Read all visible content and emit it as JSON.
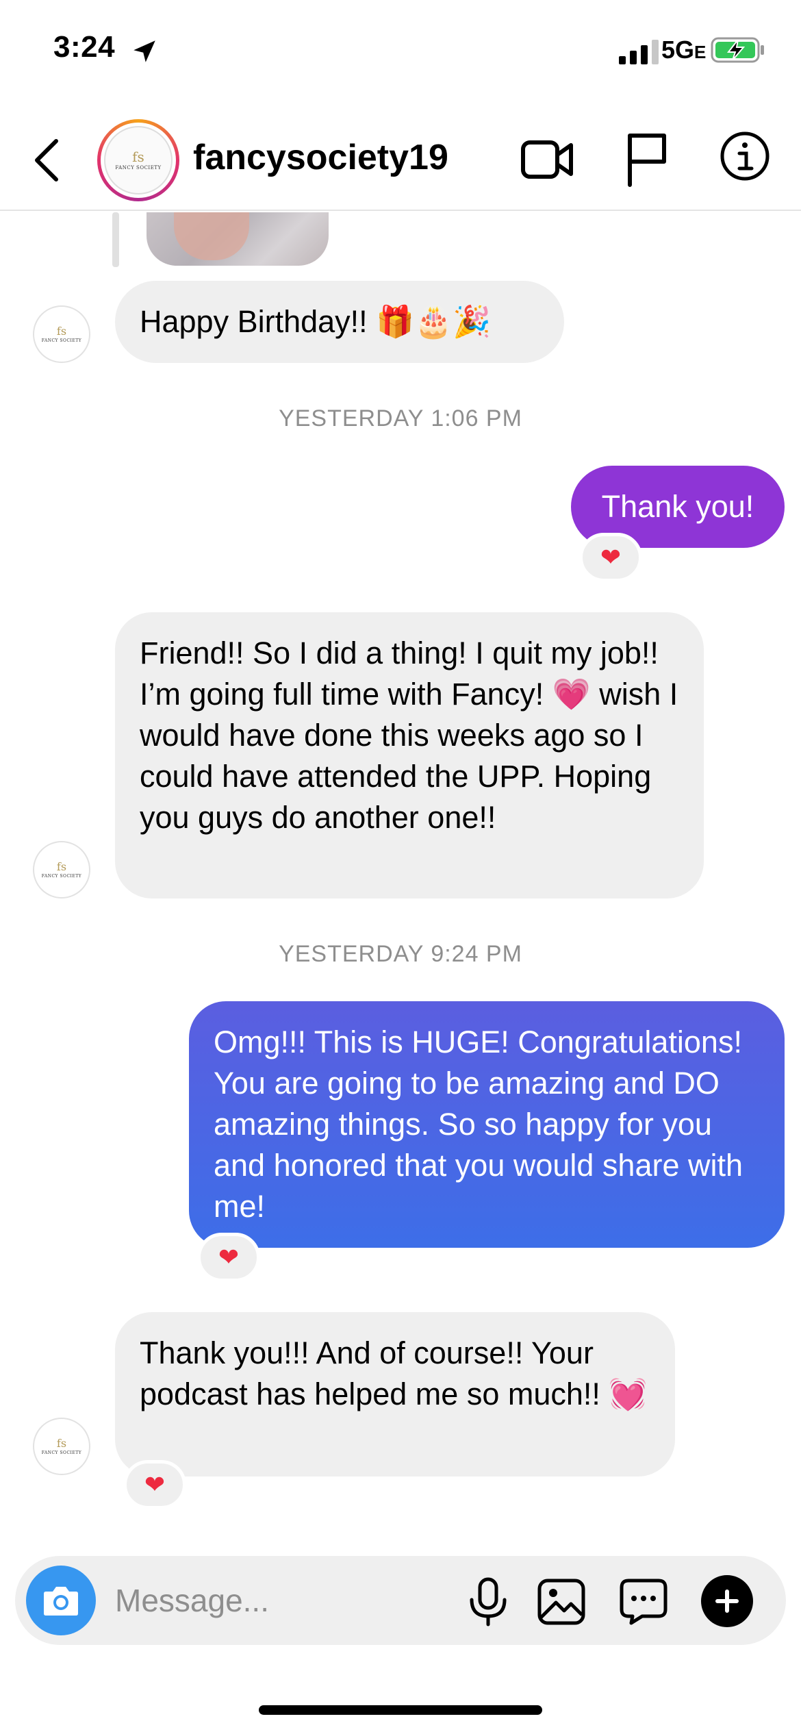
{
  "status_bar": {
    "time": "3:24",
    "network": "5G",
    "network_suffix": "E"
  },
  "header": {
    "username": "fancysociety19",
    "avatar_logo_text": "FANCY SOCIETY",
    "avatar_logo_mark": "fs"
  },
  "messages": [
    {
      "type": "received",
      "text": "Happy Birthday!! 🎁🎂🎉"
    },
    {
      "type": "timestamp",
      "text": "YESTERDAY 1:06 PM"
    },
    {
      "type": "sent",
      "text": "Thank you!",
      "reaction": "❤"
    },
    {
      "type": "received",
      "text": "Friend!! So I did a thing! I quit my job!! I’m going full time with Fancy! 💗 wish I would have done this weeks ago so I could have attended the UPP. Hoping you guys do another one!!"
    },
    {
      "type": "timestamp",
      "text": "YESTERDAY 9:24 PM"
    },
    {
      "type": "sent",
      "text": "Omg!!! This is HUGE! Congratulations! You are going to be amazing and DO amazing things. So so happy for you and honored that you would share with me!",
      "reaction": "❤"
    },
    {
      "type": "received",
      "text": "Thank you!!! And of course!! Your podcast has helped me so much!! 💓",
      "reaction": "❤"
    }
  ],
  "composer": {
    "placeholder": "Message..."
  },
  "colors": {
    "sent_purple": "#8e35d6",
    "sent_blue": "#3d6ee8",
    "received_bg": "#efefef",
    "camera_blue": "#3797f0",
    "reaction_heart": "#ed2a3f"
  },
  "icons": [
    "location-arrow-icon",
    "signal-icon",
    "battery-charging-icon",
    "back-icon",
    "video-call-icon",
    "flag-icon",
    "info-icon",
    "camera-icon",
    "microphone-icon",
    "gallery-icon",
    "sticker-icon",
    "plus-icon"
  ]
}
